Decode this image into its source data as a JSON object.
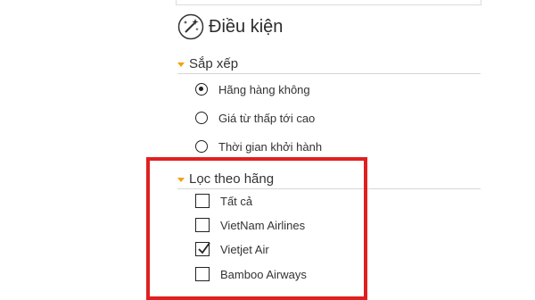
{
  "panel": {
    "title": "Điều kiện",
    "title_icon": "magic-wand-icon"
  },
  "sort": {
    "label": "Sắp xếp",
    "options": [
      {
        "label": "Hãng hàng không",
        "selected": true
      },
      {
        "label": "Giá từ thấp tới cao",
        "selected": false
      },
      {
        "label": "Thời gian khởi hành",
        "selected": false
      }
    ]
  },
  "filter": {
    "label": "Lọc theo hãng",
    "options": [
      {
        "label": "Tất cả",
        "checked": false
      },
      {
        "label": "VietNam Airlines",
        "checked": false
      },
      {
        "label": "Vietjet Air",
        "checked": true
      },
      {
        "label": "Bamboo Airways",
        "checked": false
      }
    ]
  },
  "colors": {
    "caret": "#f0a30a",
    "highlight_frame": "#e02020"
  }
}
